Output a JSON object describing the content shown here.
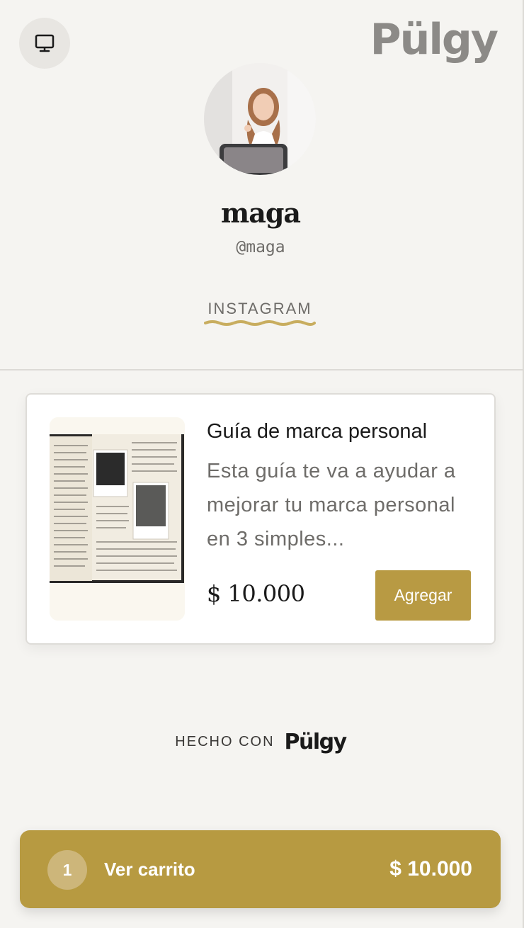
{
  "header": {
    "device_toggle_icon": "monitor-icon",
    "brand": "Pülgy"
  },
  "profile": {
    "name": "maga",
    "handle": "@maga",
    "tab": "INSTAGRAM"
  },
  "product": {
    "title": "Guía de marca personal",
    "description": "Esta guía te va a ayudar a mejorar tu marca personal en 3 simples...",
    "price": "$ 10.000",
    "add_label": "Agregar"
  },
  "footer": {
    "made_with": "HECHO CON",
    "brand": "Pülgy"
  },
  "cart": {
    "count": "1",
    "label": "Ver carrito",
    "total": "$ 10.000"
  },
  "colors": {
    "background": "#f5f4f1",
    "accent": "#b89a43",
    "text": "#1a1a1a",
    "muted": "#6e6c69"
  }
}
